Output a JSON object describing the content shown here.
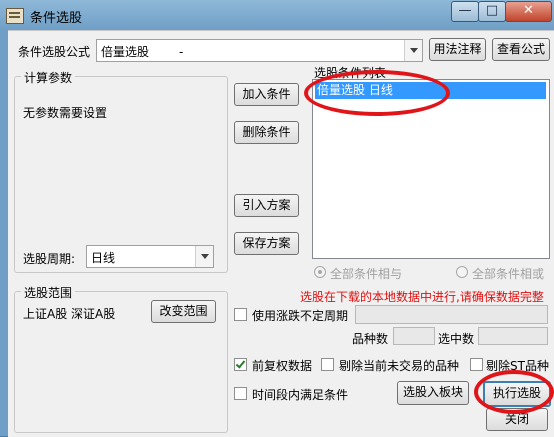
{
  "window": {
    "title": "条件选股",
    "min_glyph": "—",
    "max_glyph": "□",
    "close_glyph": "✕"
  },
  "formula": {
    "label": "条件选股公式",
    "value": "倍量选股",
    "value_suffix": "-",
    "usage_button": "用法注释",
    "view_button": "查看公式"
  },
  "params": {
    "title": "计算参数",
    "empty_text": "无参数需要设置",
    "period_label": "选股周期:",
    "period_value": "日线"
  },
  "scope": {
    "title": "选股范围",
    "markets": "上证A股  深证A股",
    "change_button": "改变范围"
  },
  "actions": {
    "add": "加入条件",
    "delete": "删除条件",
    "import": "引入方案",
    "save": "保存方案"
  },
  "conditions": {
    "title": "选股条件列表",
    "items": [
      "倍量选股   日线"
    ]
  },
  "logic": {
    "and_label": "全部条件相与",
    "or_label": "全部条件相或"
  },
  "warning": "选股在下载的本地数据中进行,请确保数据完整",
  "options": {
    "undetermined_period": "使用涨跌不定周期",
    "stock_count_label": "品种数",
    "selected_count_label": "选中数",
    "forward_adjust": "前复权数据",
    "exclude_untraded": "剔除当前未交易的品种",
    "exclude_st": "剔除ST品种",
    "time_range": "时间段内满足条件"
  },
  "buttons": {
    "to_sector": "选股入板块",
    "execute": "执行选股",
    "close": "关闭"
  },
  "colors": {
    "highlight": "#e0151a",
    "selection": "#3399ff",
    "warning": "#e01010"
  }
}
